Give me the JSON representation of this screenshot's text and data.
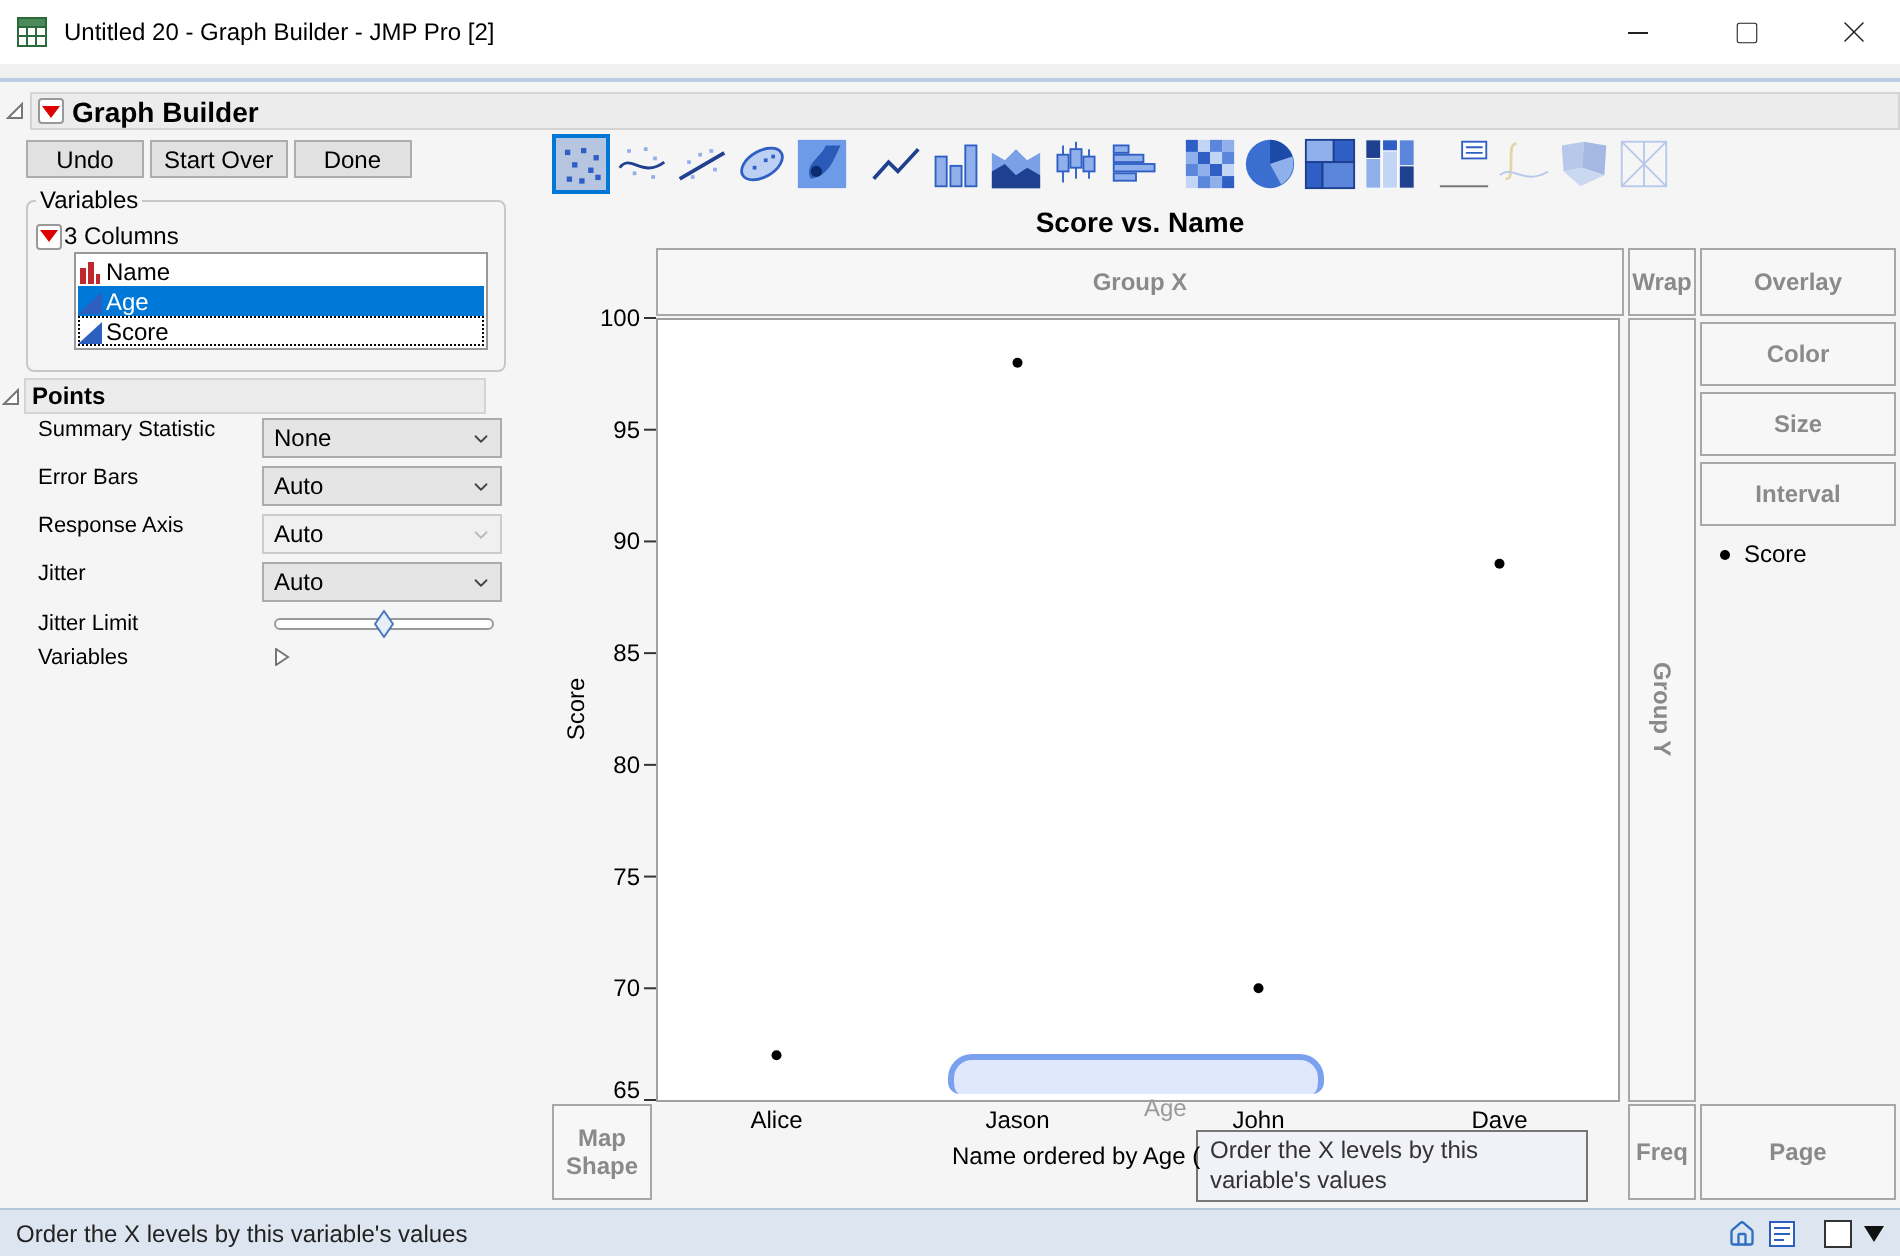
{
  "window": {
    "title": "Untitled 20 - Graph Builder - JMP Pro [2]"
  },
  "header": {
    "title": "Graph Builder",
    "expanded": true
  },
  "buttons": [
    "Undo",
    "Start Over",
    "Done"
  ],
  "variables": {
    "legend": "Variables",
    "columns_label": "3 Columns",
    "items": [
      {
        "name": "Name",
        "kind": "nominal",
        "selected": false,
        "focused": false
      },
      {
        "name": "Age",
        "kind": "continuous",
        "selected": true,
        "focused": false
      },
      {
        "name": "Score",
        "kind": "continuous",
        "selected": false,
        "focused": true
      }
    ]
  },
  "points": {
    "title": "Points",
    "expanded": true,
    "options": [
      {
        "label": "Summary Statistic",
        "kind": "dropdown",
        "value": "None",
        "disabled": false
      },
      {
        "label": "Error Bars",
        "kind": "dropdown",
        "value": "Auto",
        "disabled": false
      },
      {
        "label": "Response Axis",
        "kind": "dropdown",
        "value": "Auto",
        "disabled": true
      },
      {
        "label": "Jitter",
        "kind": "dropdown",
        "value": "Auto",
        "disabled": false
      },
      {
        "label": "Jitter Limit",
        "kind": "slider",
        "level": 0.5
      },
      {
        "label": "Variables",
        "kind": "disclosure",
        "expanded": false
      }
    ]
  },
  "toolbar": [
    [
      {
        "kind": "points",
        "selected": true,
        "disabled": false
      },
      {
        "kind": "smoother",
        "selected": false,
        "disabled": false
      },
      {
        "kind": "line_of_fit",
        "selected": false,
        "disabled": false
      },
      {
        "kind": "ellipse",
        "selected": false,
        "disabled": false
      },
      {
        "kind": "contour",
        "selected": false,
        "disabled": false
      }
    ],
    [
      {
        "kind": "line",
        "selected": false,
        "disabled": false
      },
      {
        "kind": "bar",
        "selected": false,
        "disabled": false
      },
      {
        "kind": "area",
        "selected": false,
        "disabled": false
      },
      {
        "kind": "box_plot",
        "selected": false,
        "disabled": false
      },
      {
        "kind": "histogram",
        "selected": false,
        "disabled": false
      }
    ],
    [
      {
        "kind": "heatmap",
        "selected": false,
        "disabled": false
      },
      {
        "kind": "pie",
        "selected": false,
        "disabled": false
      },
      {
        "kind": "treemap",
        "selected": false,
        "disabled": false
      },
      {
        "kind": "mosaic",
        "selected": false,
        "disabled": false
      }
    ],
    [
      {
        "kind": "caption_box",
        "selected": false,
        "disabled": false
      },
      {
        "kind": "formula",
        "selected": false,
        "disabled": true
      },
      {
        "kind": "map_shape",
        "selected": false,
        "disabled": true
      },
      {
        "kind": "parallel",
        "selected": false,
        "disabled": true
      }
    ]
  ],
  "graph": {
    "chart_data": {
      "type": "scatter",
      "title": "Score vs. Name",
      "xlabel": "Name ordered by Age (",
      "ylabel": "Score",
      "categories": [
        "Alice",
        "Jason",
        "John",
        "Dave"
      ],
      "series": [
        {
          "name": "Score",
          "color": "#000000",
          "values": [
            67,
            98,
            70,
            89
          ]
        }
      ],
      "ylim": [
        65,
        100
      ],
      "yticks": [
        65,
        70,
        75,
        80,
        85,
        90,
        95,
        100
      ]
    },
    "zones": {
      "group_x": "Group X",
      "wrap": "Wrap",
      "overlay": "Overlay",
      "colour_by": "Color",
      "size": "Size",
      "interval": "Interval",
      "group_y": "Group Y",
      "map_shape": "Map Shape",
      "freq": "Freq",
      "page": "Page"
    },
    "drag_label": "Age",
    "tooltip": "Order the X levels by this variable's values"
  },
  "status_bar": {
    "text": "Order the X levels by this variable's values",
    "checked": false
  }
}
